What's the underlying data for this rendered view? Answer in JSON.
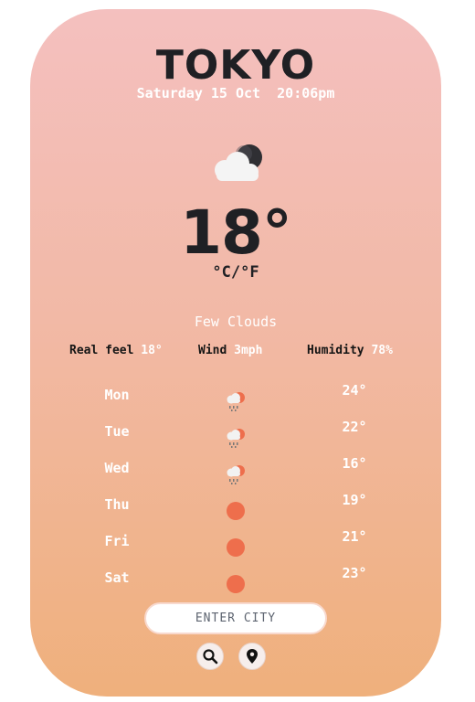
{
  "location": {
    "city": "TOKYO",
    "datetime": "Saturday 15 Oct  20:06pm"
  },
  "current": {
    "icon": "cloud-moon-icon",
    "temperature": "18°",
    "unit_toggle": "°C/°F",
    "description": "Few Clouds"
  },
  "stats": {
    "real_feel_label": "Real feel",
    "real_feel_value": "18°",
    "wind_label": "Wind",
    "wind_value": "3mph",
    "humidity_label": "Humidity",
    "humidity_value": "78%"
  },
  "forecast": [
    {
      "day": "Mon",
      "icon": "rain-sun-icon",
      "temp": "24°"
    },
    {
      "day": "Tue",
      "icon": "rain-sun-icon",
      "temp": "22°"
    },
    {
      "day": "Wed",
      "icon": "rain-sun-icon",
      "temp": "16°"
    },
    {
      "day": "Thu",
      "icon": "sun-icon",
      "temp": "19°"
    },
    {
      "day": "Fri",
      "icon": "sun-icon",
      "temp": "21°"
    },
    {
      "day": "Sat",
      "icon": "sun-icon",
      "temp": "23°"
    }
  ],
  "search": {
    "placeholder": "ENTER CITY",
    "search_icon": "search-icon",
    "location_icon": "location-pin-icon"
  },
  "colors": {
    "gradient_top": "#f4c0bf",
    "gradient_bottom": "#efb07c",
    "text_dark": "#1f2024",
    "text_light": "#ffffff",
    "sun": "#ee6e4c"
  }
}
